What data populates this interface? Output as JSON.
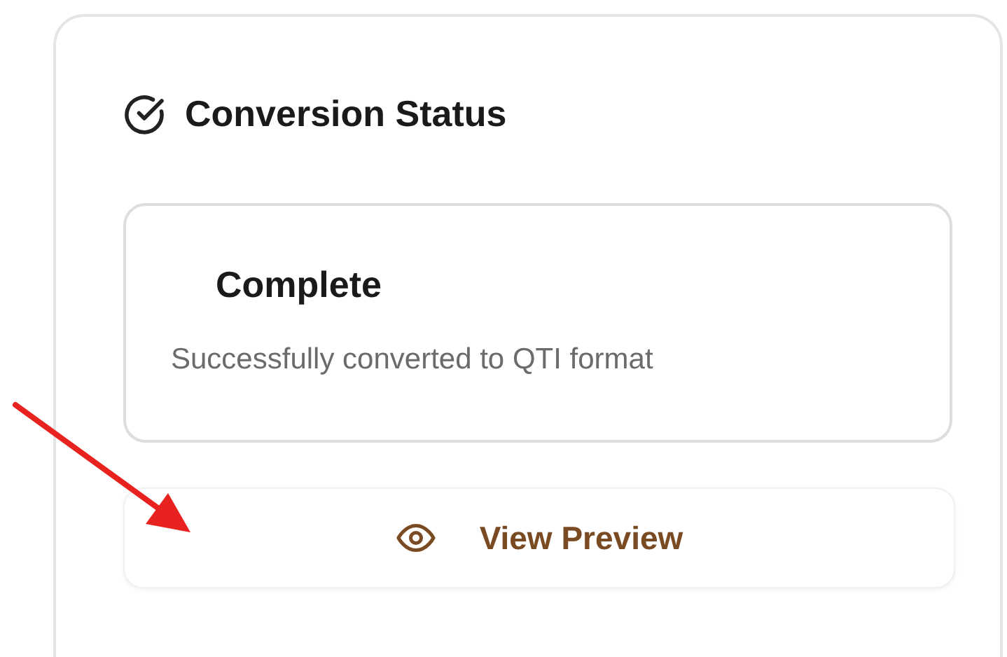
{
  "card": {
    "title": "Conversion Status"
  },
  "status": {
    "title": "Complete",
    "message": "Successfully converted to QTI format"
  },
  "preview_button": {
    "label": "View Preview"
  }
}
